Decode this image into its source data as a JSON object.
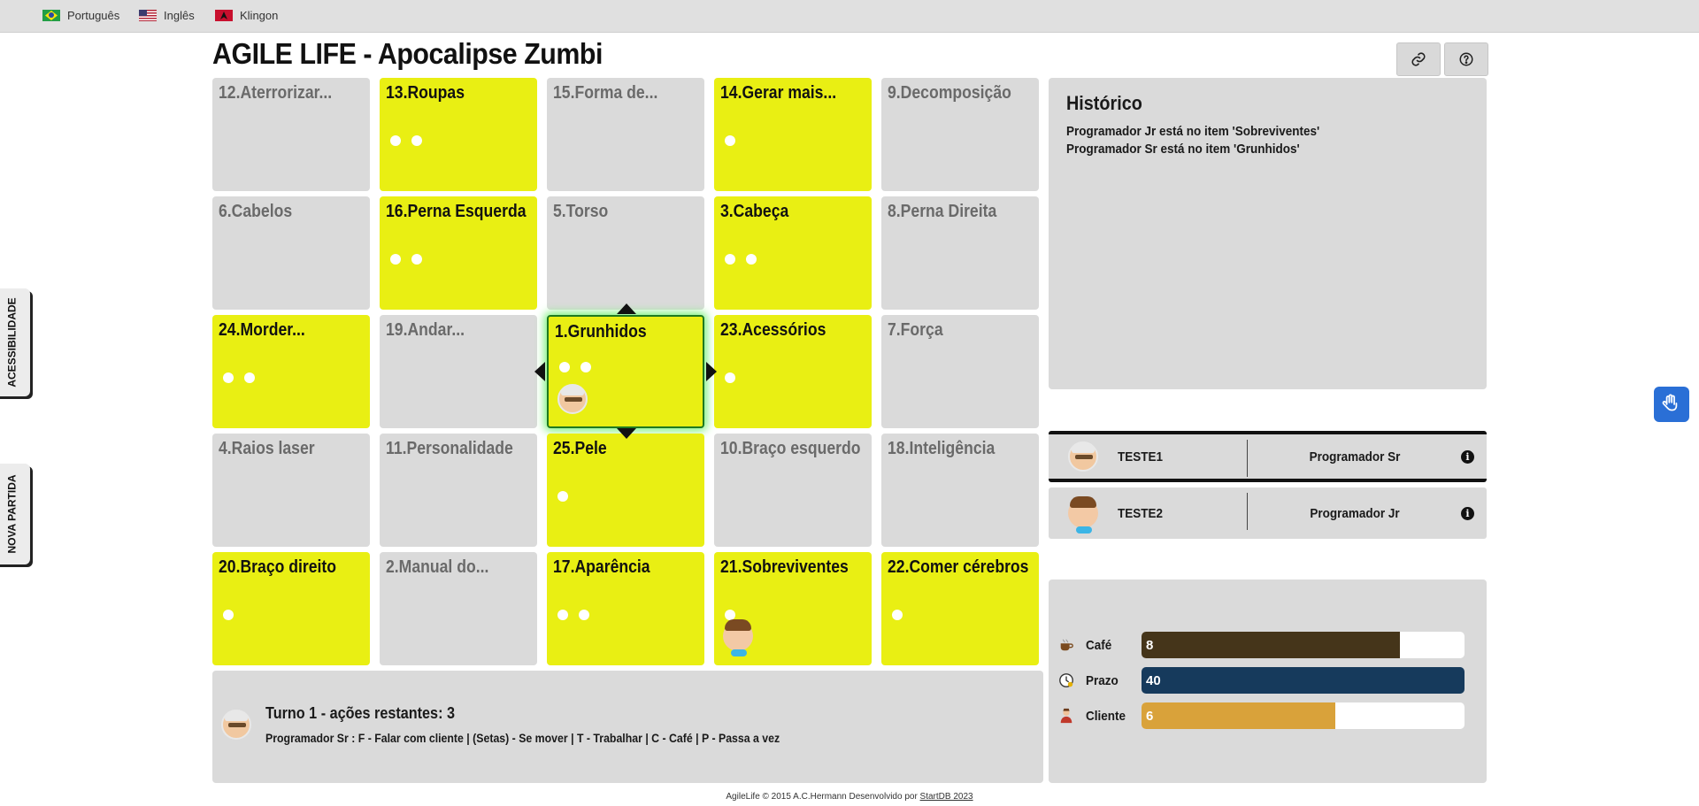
{
  "languages": [
    {
      "label": "Português",
      "flag": "brazil-flag-icon"
    },
    {
      "label": "Inglês",
      "flag": "usa-flag-icon"
    },
    {
      "label": "Klingon",
      "flag": "klingon-flag-icon"
    }
  ],
  "title": "AGILE LIFE - Apocalipse Zumbi",
  "side_tabs": {
    "accessibility": "ACESSIBILIDADE",
    "new_game": "NOVA PARTIDA"
  },
  "board": {
    "cells": [
      {
        "label": "12.Aterrorizar...",
        "state": "gray",
        "dots": 0
      },
      {
        "label": "13.Roupas",
        "state": "yellow",
        "dots": 2
      },
      {
        "label": "15.Forma de...",
        "state": "gray",
        "dots": 0
      },
      {
        "label": "14.Gerar mais...",
        "state": "yellow",
        "dots": 1
      },
      {
        "label": "9.Decomposição",
        "state": "gray",
        "dots": 0
      },
      {
        "label": "6.Cabelos",
        "state": "gray",
        "dots": 0
      },
      {
        "label": "16.Perna Esquerda",
        "state": "yellow",
        "dots": 2
      },
      {
        "label": "5.Torso",
        "state": "gray",
        "dots": 0
      },
      {
        "label": "3.Cabeça",
        "state": "yellow",
        "dots": 2
      },
      {
        "label": "8.Perna Direita",
        "state": "gray",
        "dots": 0
      },
      {
        "label": "24.Morder...",
        "state": "yellow",
        "dots": 2
      },
      {
        "label": "19.Andar...",
        "state": "gray",
        "dots": 0
      },
      {
        "label": "1.Grunhidos",
        "state": "yellow",
        "dots": 2,
        "active": true,
        "token": "programador-sr"
      },
      {
        "label": "23.Acessórios",
        "state": "yellow",
        "dots": 1
      },
      {
        "label": "7.Força",
        "state": "gray",
        "dots": 0
      },
      {
        "label": "4.Raios laser",
        "state": "gray",
        "dots": 0
      },
      {
        "label": "11.Personalidade",
        "state": "gray",
        "dots": 0
      },
      {
        "label": "25.Pele",
        "state": "yellow",
        "dots": 1
      },
      {
        "label": "10.Braço esquerdo",
        "state": "gray",
        "dots": 0
      },
      {
        "label": "18.Inteligência",
        "state": "gray",
        "dots": 0
      },
      {
        "label": "20.Braço direito",
        "state": "yellow",
        "dots": 1
      },
      {
        "label": "2.Manual do...",
        "state": "gray",
        "dots": 0
      },
      {
        "label": "17.Aparência",
        "state": "yellow",
        "dots": 2
      },
      {
        "label": "21.Sobreviventes",
        "state": "yellow",
        "dots": 1,
        "token": "programador-jr"
      },
      {
        "label": "22.Comer cérebros",
        "state": "yellow",
        "dots": 1
      }
    ]
  },
  "history": {
    "title": "Histórico",
    "lines": [
      "Programador Jr está no item 'Sobreviventes'",
      "Programador Sr está no item 'Grunhidos'"
    ]
  },
  "players": [
    {
      "name": "TESTE1",
      "role": "Programador Sr",
      "avatar": "senior-programmer-avatar",
      "active": true
    },
    {
      "name": "TESTE2",
      "role": "Programador Jr",
      "avatar": "junior-programmer-avatar",
      "active": false
    }
  ],
  "resources": [
    {
      "label": "Café",
      "value": "8",
      "fraction": 0.8,
      "color": "#45351a",
      "icon": "coffee-icon"
    },
    {
      "label": "Prazo",
      "value": "40",
      "fraction": 1.0,
      "color": "#163a5c",
      "icon": "clock-icon"
    },
    {
      "label": "Cliente",
      "value": "6",
      "fraction": 0.6,
      "color": "#d9a23a",
      "icon": "client-icon"
    }
  ],
  "status": {
    "turn": "Turno 1 - ações restantes: 3",
    "keys": "Programador Sr : F - Falar com cliente | (Setas) - Se mover | T - Trabalhar | C - Café | P - Passa a vez"
  },
  "footer": {
    "text": "AgileLife © 2015 A.C.Hermann Desenvolvido por ",
    "link": "StartDB 2023"
  },
  "colors": {
    "gray_cell": "#dadada",
    "yellow_cell": "#e9ef13",
    "active_glow": "#7cf07c"
  }
}
